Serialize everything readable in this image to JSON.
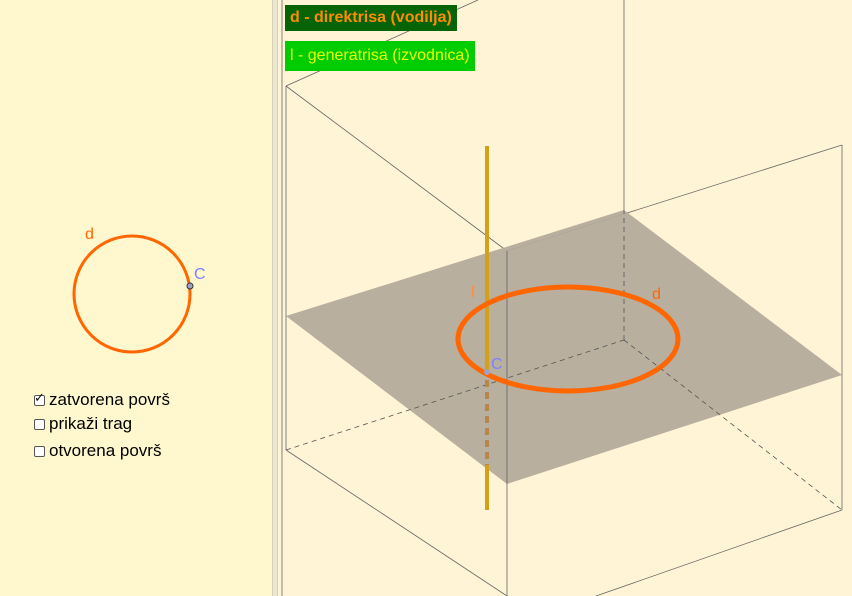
{
  "left_panel": {
    "circle_label": "d",
    "point_label": "C",
    "checkboxes": [
      {
        "label": "zatvorena površ",
        "checked": true
      },
      {
        "label": "prikaži trag",
        "checked": false
      },
      {
        "label": "otvorena površ",
        "checked": false
      }
    ]
  },
  "view3d": {
    "legend_directrix": "d - direktrisa (vodilja)",
    "legend_generatrix": "l - generatrisa (izvodnica)",
    "label_l": "l",
    "label_d": "d",
    "label_c": "C"
  },
  "colors": {
    "curve": "#ff6600",
    "point_label": "#8080ff",
    "generatrix": "#d4a017",
    "plane": "#b4ab9c",
    "legend_d_bg": "#066406",
    "legend_d_text": "#ff8c00",
    "legend_l_bg": "#00cc00",
    "legend_l_text": "#e8ff00"
  }
}
